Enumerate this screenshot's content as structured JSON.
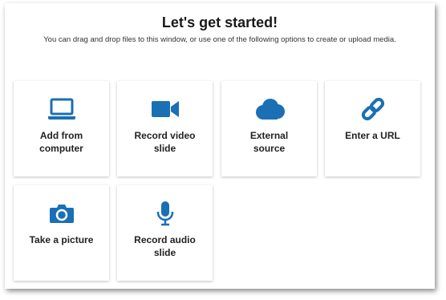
{
  "header": {
    "title": "Let's get started!",
    "subtitle": "You can drag and drop files to this window, or use one of the following options to create or upload media."
  },
  "accent_color": "#1a6fb5",
  "options": [
    {
      "label_line1": "Add from",
      "label_line2": "computer",
      "icon": "laptop-icon"
    },
    {
      "label_line1": "Record video",
      "label_line2": "slide",
      "icon": "video-camera-icon"
    },
    {
      "label_line1": "External",
      "label_line2": "source",
      "icon": "cloud-icon"
    },
    {
      "label_line1": "Enter a URL",
      "label_line2": "",
      "icon": "link-icon"
    },
    {
      "label_line1": "Take a picture",
      "label_line2": "",
      "icon": "camera-icon"
    },
    {
      "label_line1": "Record audio",
      "label_line2": "slide",
      "icon": "microphone-icon"
    }
  ]
}
